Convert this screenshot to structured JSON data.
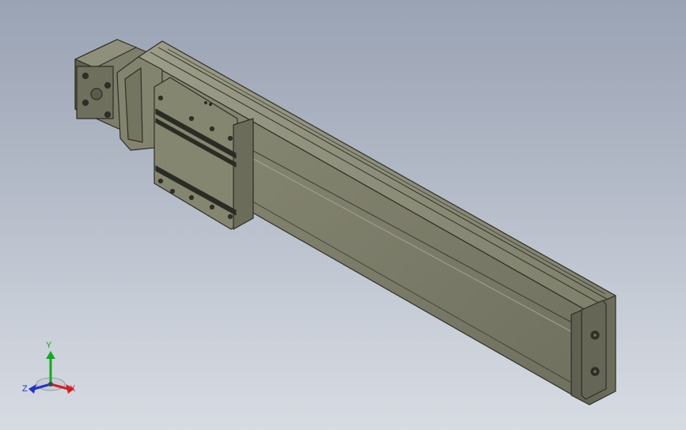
{
  "triad": {
    "x_label": "X",
    "y_label": "Y",
    "z_label": "Z",
    "colors": {
      "x": "#cc2222",
      "y": "#11aa22",
      "z": "#2233cc"
    }
  },
  "model": {
    "body_color": "#7c7d6a",
    "edge_color": "#2e2f26"
  }
}
